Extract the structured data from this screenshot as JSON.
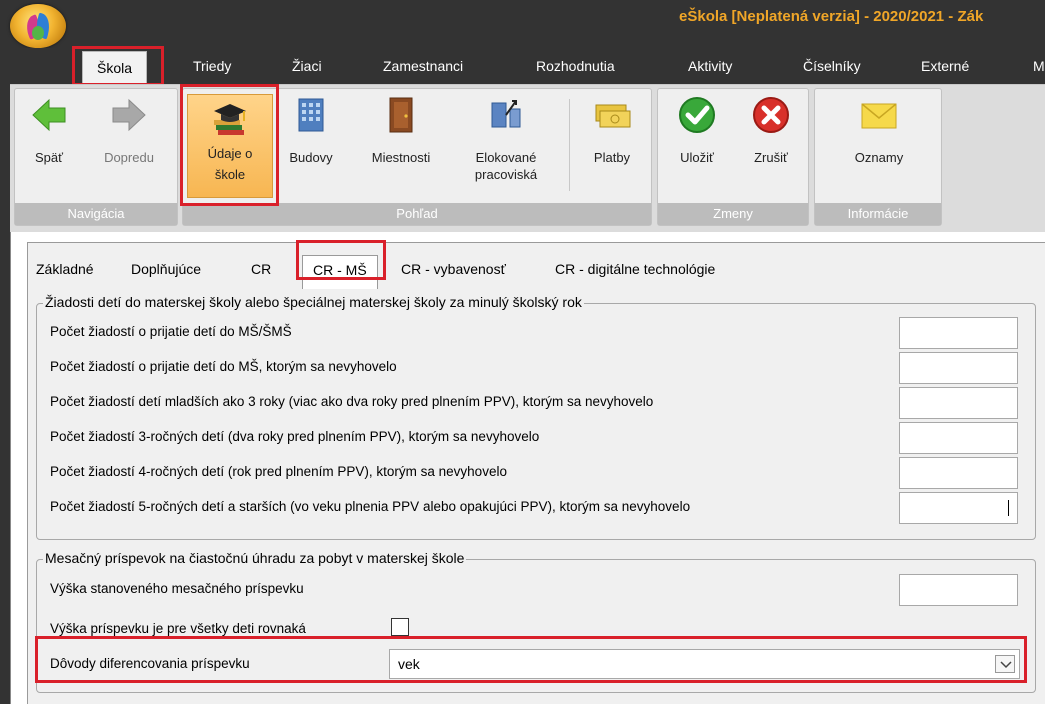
{
  "window": {
    "title": "eŠkola [Neplatená verzia] - 2020/2021 - Zák"
  },
  "menu": {
    "tabs": [
      "Škola",
      "Triedy",
      "Žiaci",
      "Zamestnanci",
      "Rozhodnutia",
      "Aktivity",
      "Číselníky",
      "Externé",
      "M"
    ],
    "active": "Škola"
  },
  "ribbon": {
    "groups": {
      "navigation": "Navigácia",
      "view": "Pohľad",
      "changes": "Zmeny",
      "info": "Informácie"
    },
    "buttons": {
      "back": "Späť",
      "forward": "Dopredu",
      "school_data_1": "Údaje o",
      "school_data_2": "škole",
      "buildings": "Budovy",
      "rooms": "Miestnosti",
      "detached_1": "Elokované",
      "detached_2": "pracoviská",
      "payments": "Platby",
      "save": "Uložiť",
      "cancel": "Zrušiť",
      "announcements": "Oznamy"
    }
  },
  "subtabs": [
    "Základné",
    "Doplňujúce",
    "CR",
    "CR - MŠ",
    "CR - vybavenosť",
    "CR - digitálne technológie"
  ],
  "section1": {
    "legend": "Žiadosti detí do materskej školy alebo špeciálnej materskej školy za minulý školský rok",
    "rows": [
      {
        "label": "Počet žiadostí o prijatie detí do MŠ/ŠMŠ",
        "value": ""
      },
      {
        "label": "Počet žiadostí o prijatie detí do MŠ, ktorým sa nevyhovelo",
        "value": ""
      },
      {
        "label": "Počet žiadostí detí mladších ako 3 roky (viac ako dva roky pred plnením PPV), ktorým sa nevyhovelo",
        "value": ""
      },
      {
        "label": "Počet žiadostí 3-ročných detí (dva roky pred plnením PPV), ktorým sa nevyhovelo",
        "value": ""
      },
      {
        "label": "Počet žiadostí 4-ročných detí (rok pred plnením PPV), ktorým sa nevyhovelo",
        "value": ""
      },
      {
        "label": "Počet žiadostí 5-ročných detí a starších (vo veku plnenia PPV alebo opakujúci PPV), ktorým sa nevyhovelo",
        "value": ""
      }
    ]
  },
  "section2": {
    "legend": "Mesačný príspevok na čiastočnú úhradu za pobyt v materskej škole",
    "fee_label": "Výška stanoveného mesačného príspevku",
    "fee_value": "",
    "same_label": "Výška príspevku je pre všetky deti rovnaká",
    "same_checked": false,
    "reason_label": "Dôvody diferencovania príspevku",
    "reason_value": "vek"
  },
  "colors": {
    "highlight": "#d9202a",
    "title_accent": "#f0a628"
  }
}
